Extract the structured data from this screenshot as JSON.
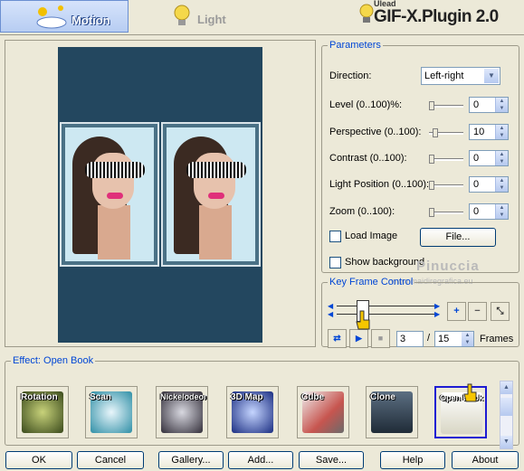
{
  "tabs": {
    "motion": "Motion",
    "light": "Light"
  },
  "brand": {
    "small": "Ulead",
    "title": "GIF-X.Plugin 2.0"
  },
  "parameters": {
    "legend": "Parameters",
    "direction_label": "Direction:",
    "direction_value": "Left-right",
    "rows": [
      {
        "label": "Level (0..100)%:",
        "value": "0"
      },
      {
        "label": "Perspective (0..100):",
        "value": "10"
      },
      {
        "label": "Contrast (0..100):",
        "value": "0"
      },
      {
        "label": "Light Position (0..100):",
        "value": "0"
      },
      {
        "label": "Zoom (0..100):",
        "value": "0"
      }
    ],
    "load_image": "Load Image",
    "file_button": "File...",
    "show_background": "Show background"
  },
  "keyframe": {
    "legend": "Key Frame Control",
    "current_frame": "3",
    "separator": "/",
    "total_frames": "15",
    "frames_label": "Frames"
  },
  "watermark": {
    "name": "Pinuccia",
    "url": "www.maidiregrafica.eu"
  },
  "effects": {
    "legend": "Effect: Open Book",
    "items": [
      {
        "name": "Rotation",
        "color": "#55662d"
      },
      {
        "name": "Scan",
        "color": "#2f8fa6"
      },
      {
        "name": "Nickelodeon",
        "color": "#8a8a92"
      },
      {
        "name": "3D Map",
        "color": "#2b48a8"
      },
      {
        "name": "Cube",
        "color": "#c7554f"
      },
      {
        "name": "Clone",
        "color": "#3a4b5c"
      },
      {
        "name": "Open Book",
        "color": "#f3f1e3"
      }
    ]
  },
  "buttons": {
    "ok": "OK",
    "cancel": "Cancel",
    "gallery": "Gallery...",
    "add": "Add...",
    "save": "Save...",
    "help": "Help",
    "about": "About"
  }
}
